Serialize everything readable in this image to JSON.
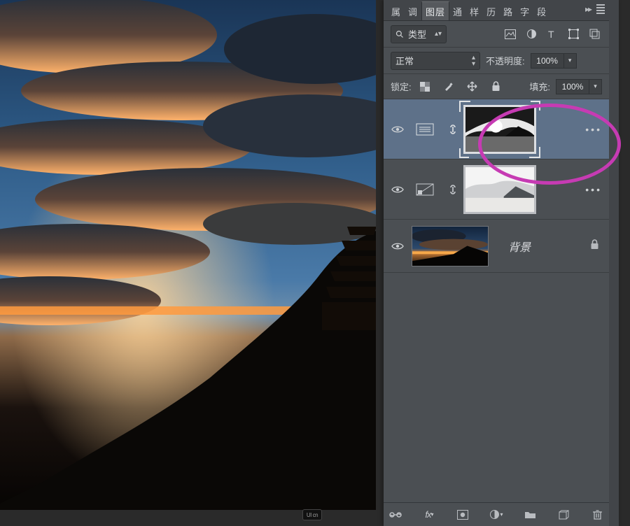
{
  "tabs": {
    "items": [
      "属",
      "调",
      "图层",
      "通",
      "样",
      "历",
      "路",
      "字",
      "段"
    ],
    "active_index": 2,
    "expand": "▸▸",
    "menu": "≡"
  },
  "filter_row": {
    "search_icon": "search-icon",
    "filter_kind": "类型",
    "filter_arrows": "▴▾"
  },
  "blend_row": {
    "mode": "正常",
    "opacity_label": "不透明度:",
    "opacity_value": "100%"
  },
  "lock_row": {
    "label": "锁定:",
    "fill_label": "填充:",
    "fill_value": "100%"
  },
  "layers": {
    "layer1": {
      "type": "mask",
      "active": true
    },
    "layer2": {
      "type": "mask",
      "active": false
    },
    "bg": {
      "name": "背景"
    }
  },
  "badge": "UI cn"
}
